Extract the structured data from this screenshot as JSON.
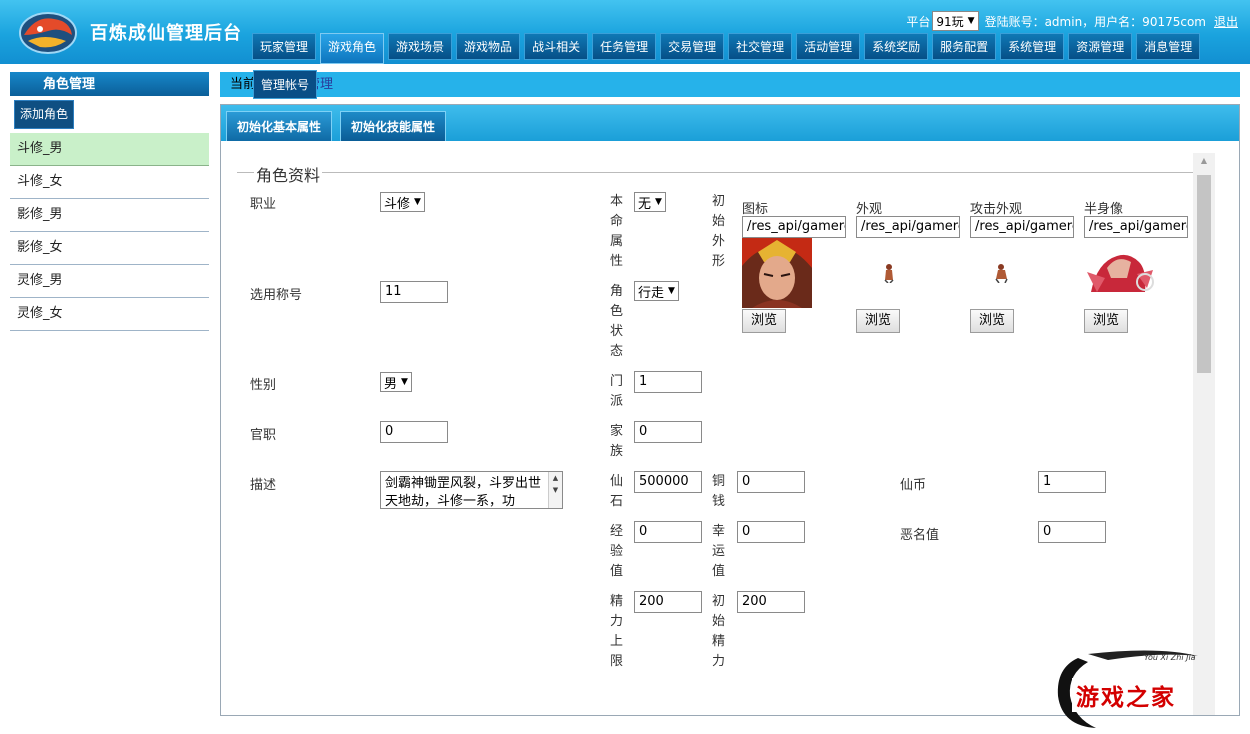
{
  "header": {
    "title": "百炼成仙管理后台",
    "platform_label": "平台",
    "platform_value": "91玩",
    "account_text": "登陆账号：admin，用户名：90175com",
    "logout": "退出"
  },
  "nav": {
    "items": [
      "玩家管理",
      "游戏角色",
      "游戏场景",
      "游戏物品",
      "战斗相关",
      "任务管理",
      "交易管理",
      "社交管理",
      "活动管理",
      "系统奖励",
      "服务配置",
      "系统管理",
      "资源管理",
      "消息管理"
    ],
    "active_index": 1,
    "submenu_item": "管理帐号"
  },
  "sidebar": {
    "title": "角色管理",
    "add_button": "添加角色",
    "roles": [
      "斗修_男",
      "斗修_女",
      "影修_男",
      "影修_女",
      "灵修_男",
      "灵修_女"
    ],
    "selected_index": 0
  },
  "breadcrumb": {
    "prefix": "当前",
    "link": "色管理"
  },
  "tabs": [
    "初始化基本属性",
    "初始化技能属性"
  ],
  "form": {
    "section_title": "角色资料",
    "profession": {
      "label": "职业",
      "value": "斗修"
    },
    "title_choice": {
      "label": "选用称号",
      "value": "11"
    },
    "gender": {
      "label": "性别",
      "value": "男"
    },
    "official_rank": {
      "label": "官职",
      "value": "0"
    },
    "description": {
      "label": "描述",
      "value": "剑霸神锄罡风裂，斗罗出世天地劫，斗修一系，功"
    },
    "natal_attribute": {
      "label": "本命属性",
      "value": "无"
    },
    "role_state": {
      "label": "角色状态",
      "value": "行走"
    },
    "sect": {
      "label": "门派",
      "value": "1"
    },
    "family": {
      "label": "家族",
      "value": "0"
    },
    "spirit_stone": {
      "label": "仙石",
      "value": "500000"
    },
    "copper": {
      "label": "铜钱",
      "value": "0"
    },
    "immortal_coin": {
      "label": "仙币",
      "value": "1"
    },
    "experience": {
      "label": "经验值",
      "value": "0"
    },
    "luck": {
      "label": "幸运值",
      "value": "0"
    },
    "infamy": {
      "label": "恶名值",
      "value": "0"
    },
    "energy_max": {
      "label": "精力上限",
      "value": "200"
    },
    "initial_energy": {
      "label": "初始精力",
      "value": "200"
    },
    "initial_appearance": {
      "label": "初始外形",
      "columns": [
        {
          "label": "图标",
          "path": "/res_api/gamere",
          "browse": "浏览"
        },
        {
          "label": "外观",
          "path": "/res_api/gamere",
          "browse": "浏览"
        },
        {
          "label": "攻击外观",
          "path": "/res_api/gamere",
          "browse": "浏览"
        },
        {
          "label": "半身像",
          "path": "/res_api/gamere",
          "browse": "浏览"
        }
      ]
    }
  },
  "watermark": {
    "text": "游戏之家",
    "script": "You Xi Zhi Jia"
  },
  "colors": {
    "header_blue": "#1aa3de",
    "nav_dark": "#064f87",
    "selected_row": "#c9f0c9",
    "watermark_red": "#d30000"
  }
}
